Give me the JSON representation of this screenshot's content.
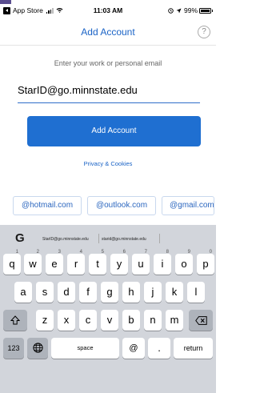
{
  "status_bar": {
    "carrier": "App Store",
    "time": "11:03 AM",
    "battery": "99%"
  },
  "nav": {
    "title": "Add Account",
    "help_glyph": "?"
  },
  "form": {
    "prompt": "Enter your work or personal email",
    "email_value": "StarID@go.minnstate.edu",
    "submit_label": "Add Account",
    "privacy_label": "Privacy & Cookies"
  },
  "domain_suggestions": [
    "@hotmail.com",
    "@outlook.com",
    "@gmail.com"
  ],
  "keyboard": {
    "suggestions": [
      "StarID@go.minnstate.edu",
      "starid@go.minnstate.edu"
    ],
    "row1": [
      {
        "key": "q",
        "num": "1"
      },
      {
        "key": "w",
        "num": "2"
      },
      {
        "key": "e",
        "num": "3"
      },
      {
        "key": "r",
        "num": "4"
      },
      {
        "key": "t",
        "num": "5"
      },
      {
        "key": "y",
        "num": "6"
      },
      {
        "key": "u",
        "num": "7"
      },
      {
        "key": "i",
        "num": "8"
      },
      {
        "key": "o",
        "num": "9"
      },
      {
        "key": "p",
        "num": "0"
      }
    ],
    "row2": [
      "a",
      "s",
      "d",
      "f",
      "g",
      "h",
      "j",
      "k",
      "l"
    ],
    "row3": [
      "z",
      "x",
      "c",
      "v",
      "b",
      "n",
      "m"
    ],
    "numbers_label": "123",
    "space_label": "space",
    "at_label": "@",
    "dot_label": ".",
    "return_label": "return"
  },
  "icons": {
    "back": "back-to-app-icon",
    "signal": "cellular-signal-icon",
    "wifi": "wifi-icon",
    "battery": "battery-icon",
    "globe": "globe-icon",
    "shift": "shift-icon",
    "backspace": "backspace-icon",
    "google": "google-g-icon"
  },
  "colors": {
    "accent": "#1f6fd1",
    "link": "#1a63c6",
    "keyboard_bg": "#d2d5db"
  }
}
